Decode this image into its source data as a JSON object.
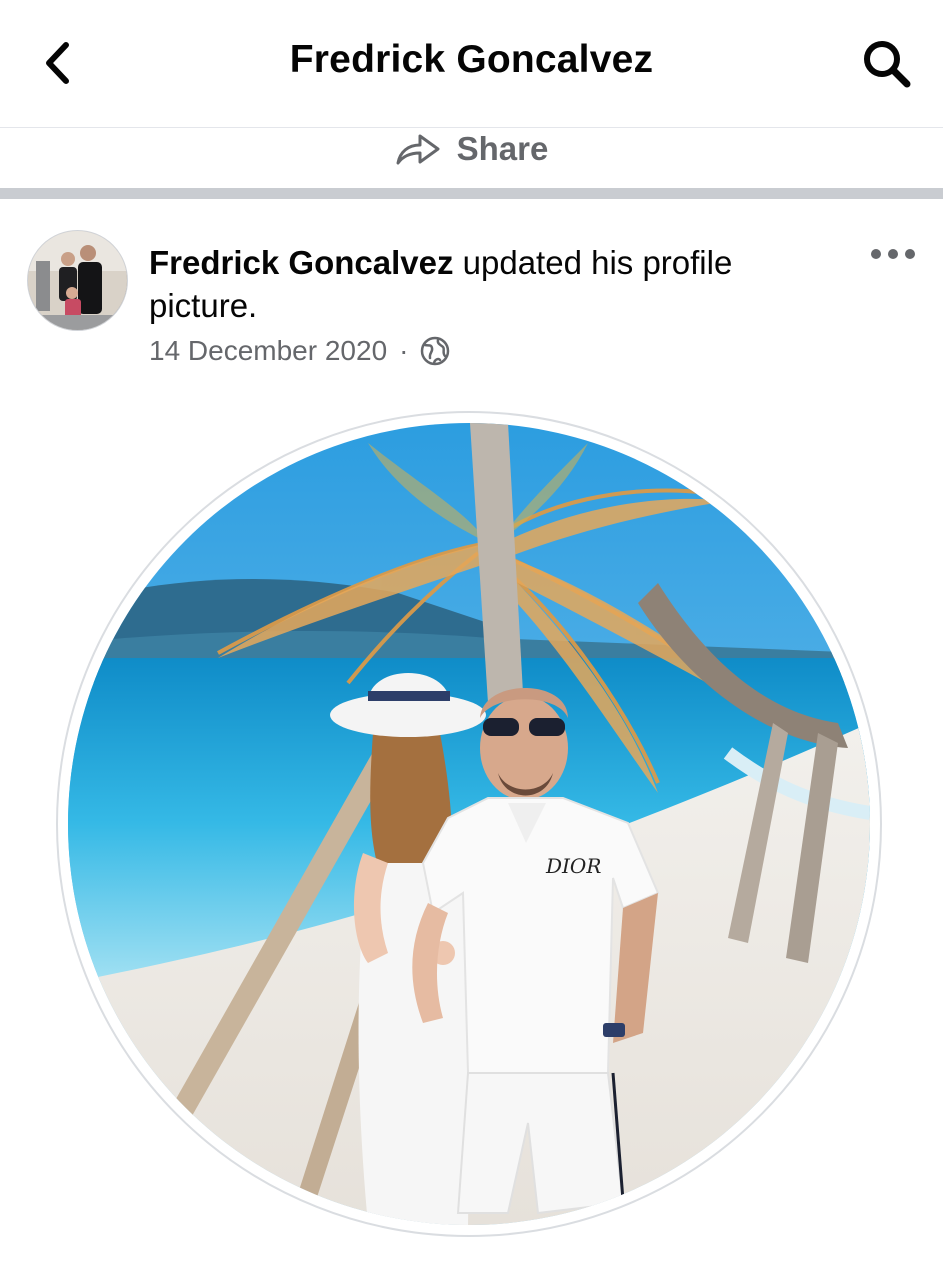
{
  "header": {
    "title": "Fredrick Goncalvez",
    "back_icon": "chevron-left-icon",
    "search_icon": "search-icon"
  },
  "actions": {
    "share_label": "Share",
    "share_icon": "share-arrow-icon"
  },
  "post": {
    "author": "Fredrick Goncalvez",
    "action_text": " updated his profile picture.",
    "date": "14 December 2020",
    "separator": "·",
    "privacy_icon": "globe-icon",
    "more_icon": "more-horizontal-icon"
  },
  "photo": {
    "shirt_logo": "DIOR"
  },
  "colors": {
    "text_primary": "#050505",
    "text_secondary": "#65676b",
    "divider": "#c9ccd1"
  }
}
